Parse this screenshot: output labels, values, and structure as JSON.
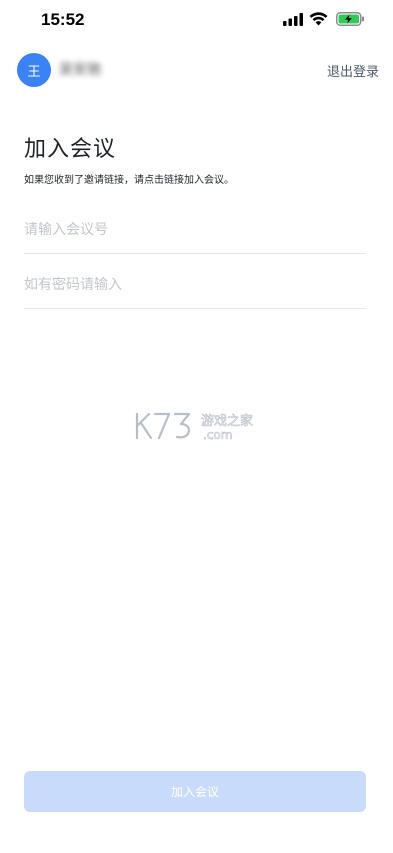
{
  "status_bar": {
    "time": "15:52"
  },
  "header": {
    "avatar_initial": "王",
    "user_name": "吴安驰",
    "logout_label": "退出登录"
  },
  "page": {
    "title": "加入会议",
    "hint": "如果您收到了邀请链接，请点击链接加入会议。"
  },
  "form": {
    "meeting_id_placeholder": "请输入会议号",
    "meeting_id_value": "",
    "password_placeholder": "如有密码请输入",
    "password_value": ""
  },
  "actions": {
    "join_label": "加入会议"
  },
  "watermark": {
    "brand": "K73",
    "site_cn": "游戏之家",
    "site_domain": ".com"
  },
  "colors": {
    "accent": "#3b82f6",
    "button_disabled_bg": "#c9dbfb",
    "divider": "#e6e8eb",
    "placeholder": "#c2c6cc"
  }
}
